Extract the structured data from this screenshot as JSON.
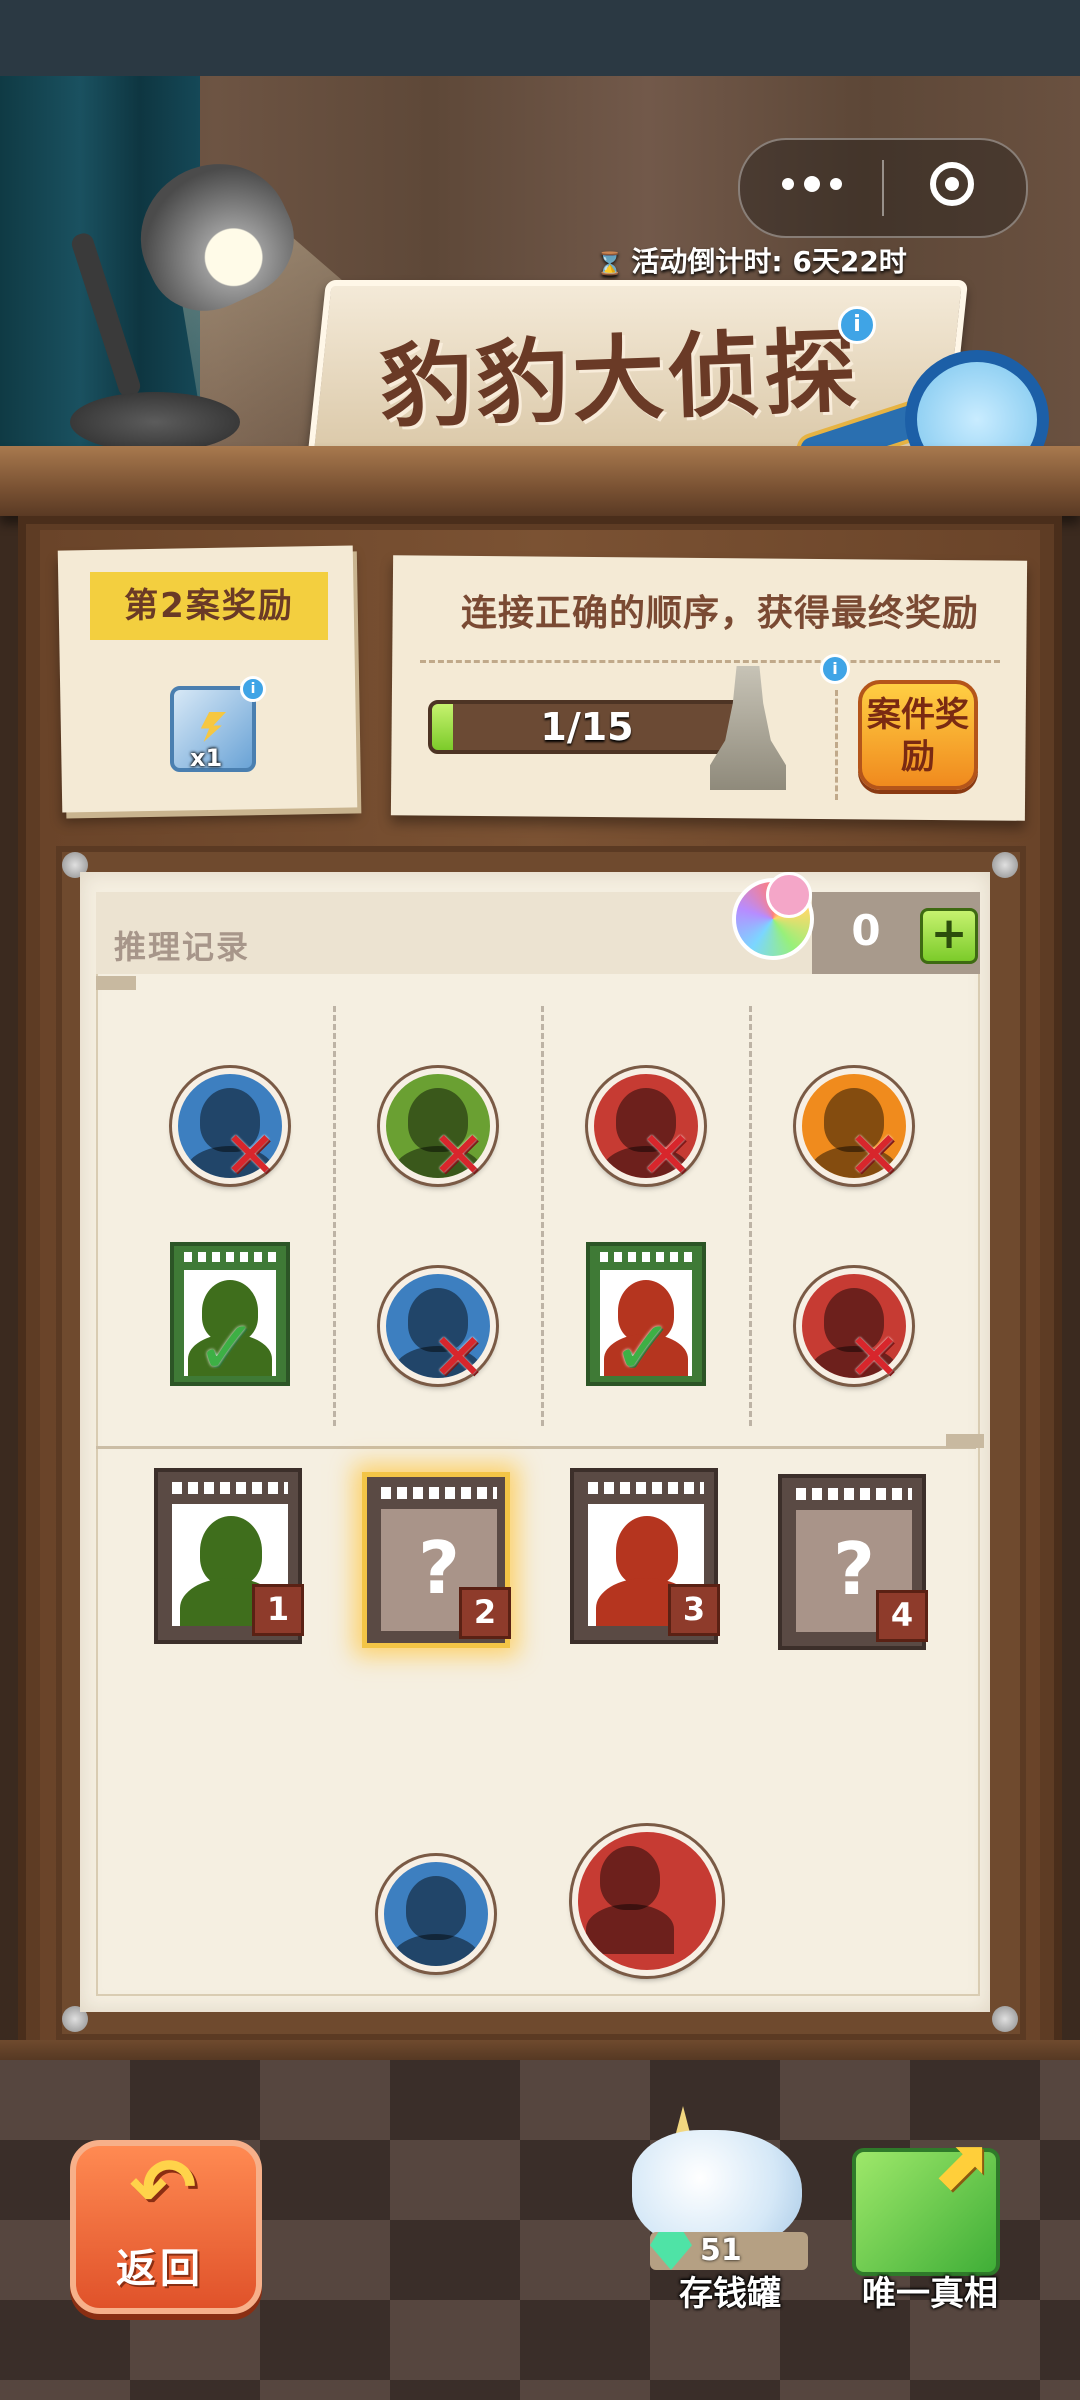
{
  "header": {
    "countdown_label": "活动倒计时: 6天22时",
    "title": "豹豹大侦探",
    "info_symbol": "i"
  },
  "capsule": {
    "menu_icon": "more-dots-icon",
    "close_icon": "target-circle-icon"
  },
  "reward": {
    "banner": "第2案奖励",
    "item_icon": "energy-cube-icon",
    "item_count": "x1",
    "info_symbol": "i"
  },
  "objective": {
    "text": "连接正确的顺序，获得最终奖励",
    "progress_text": "1/15",
    "progress_fraction": 0.067,
    "info_symbol": "i",
    "case_reward_button": "案件奖励"
  },
  "record": {
    "title": "推理记录",
    "clue_count": "0",
    "plus_symbol": "+"
  },
  "marks": {
    "wrong": "✕",
    "right": "✓"
  },
  "record_grid": [
    [
      {
        "type": "avatar",
        "color": "#3d7fc0",
        "result": "wrong"
      },
      {
        "type": "avatar",
        "color": "#6aa032",
        "result": "wrong"
      },
      {
        "type": "avatar",
        "color": "#c63b33",
        "result": "wrong"
      },
      {
        "type": "avatar",
        "color": "#f08b1d",
        "result": "wrong"
      }
    ],
    [
      {
        "type": "photo",
        "color": "#3f6e1c",
        "result": "right"
      },
      {
        "type": "avatar",
        "color": "#3d7fc0",
        "result": "wrong"
      },
      {
        "type": "photo",
        "color": "#b5351f",
        "result": "right"
      },
      {
        "type": "avatar",
        "color": "#c63b33",
        "result": "wrong"
      }
    ]
  ],
  "sequence_slots": [
    {
      "number": "1",
      "content": "silhouette",
      "color": "#3f6e1c",
      "active": false
    },
    {
      "number": "2",
      "content": "?",
      "color": "",
      "active": true
    },
    {
      "number": "3",
      "content": "silhouette",
      "color": "#b5351f",
      "active": false
    },
    {
      "number": "4",
      "content": "?",
      "color": "",
      "active": false
    }
  ],
  "candidates": [
    {
      "color": "#3d7fc0"
    },
    {
      "color": "#c63b33"
    }
  ],
  "bottom": {
    "back_label": "返回",
    "back_icon": "curved-back-arrow-icon",
    "piggy_label": "存钱罐",
    "gem_count": "51",
    "truth_label": "唯一真相"
  }
}
